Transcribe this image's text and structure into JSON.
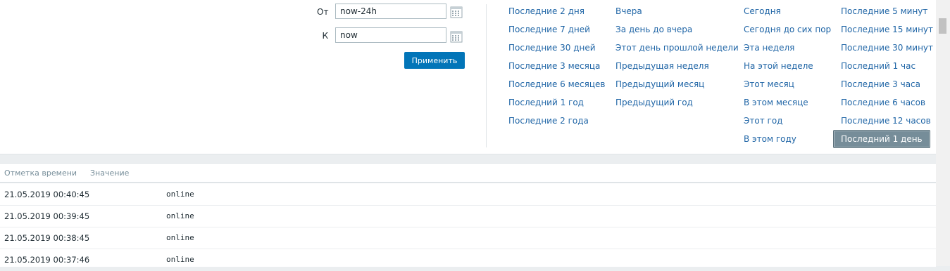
{
  "filter": {
    "from_label": "От",
    "from_value": "now-24h",
    "to_label": "К",
    "to_value": "now",
    "apply_label": "Применить",
    "calendar_icon": "calendar-icon"
  },
  "quick_ranges": {
    "col1": [
      "Последние 2 дня",
      "Последние 7 дней",
      "Последние 30 дней",
      "Последние 3 месяца",
      "Последние 6 месяцев",
      "Последний 1 год",
      "Последние 2 года"
    ],
    "col2": [
      "Вчера",
      "За день до вчера",
      "Этот день прошлой недели",
      "Предыдущая неделя",
      "Предыдущий месяц",
      "Предыдущий год"
    ],
    "col3": [
      "Сегодня",
      "Сегодня до сих пор",
      "Эта неделя",
      "На этой неделе",
      "Этот месяц",
      "В этом месяце",
      "Этот год",
      "В этом году"
    ],
    "col4": [
      "Последние 5 минут",
      "Последние 15 минут",
      "Последние 30 минут",
      "Последний 1 час",
      "Последние 3 часа",
      "Последние 6 часов",
      "Последние 12 часов",
      "Последний 1 день"
    ],
    "active": "Последний 1 день"
  },
  "table": {
    "headers": [
      "Отметка времени",
      "Значение"
    ],
    "rows": [
      {
        "time": "21.05.2019 00:40:45",
        "value": "online"
      },
      {
        "time": "21.05.2019 00:39:45",
        "value": "online"
      },
      {
        "time": "21.05.2019 00:38:45",
        "value": "online"
      },
      {
        "time": "21.05.2019 00:37:46",
        "value": "online"
      }
    ]
  }
}
